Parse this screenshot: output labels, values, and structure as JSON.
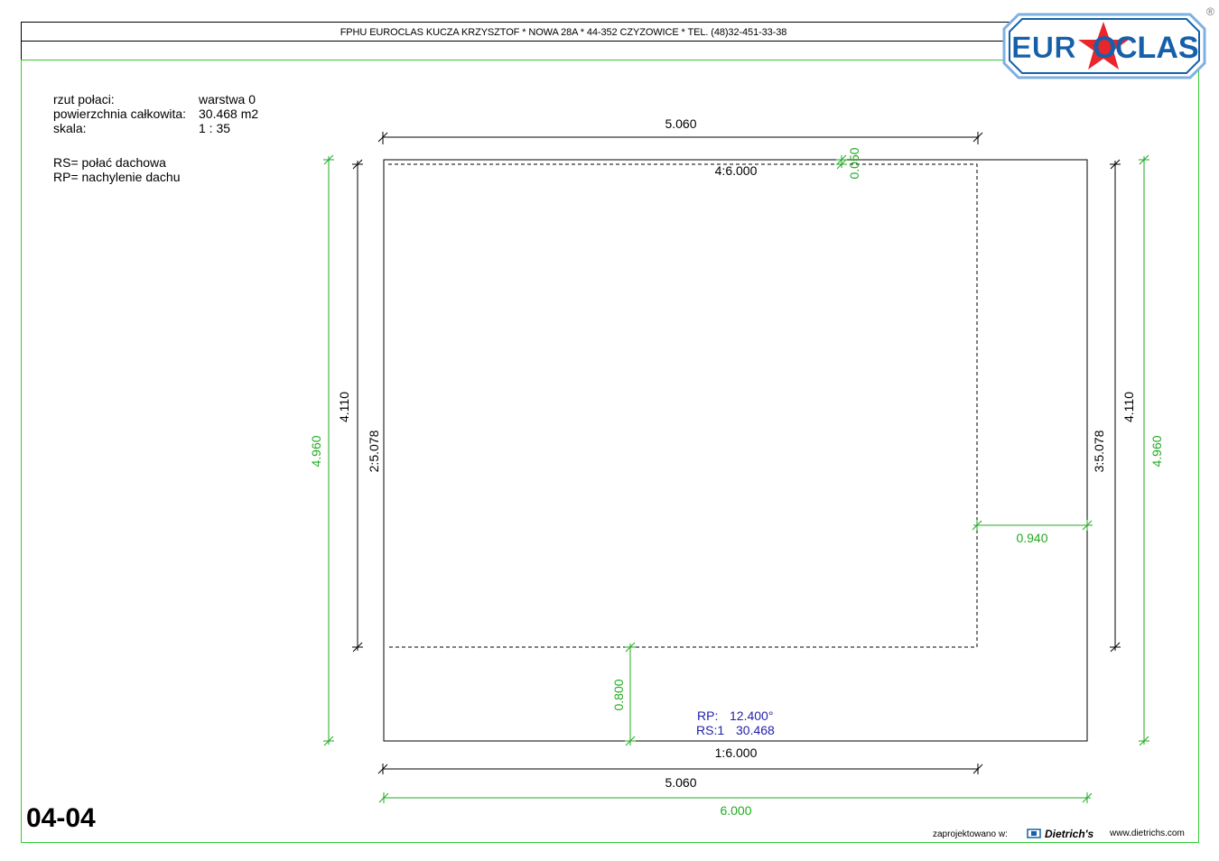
{
  "header": {
    "company": "FPHU EUROCLAS KUCZA KRZYSZTOF * NOWA 28A * 44-352 CZYZOWICE * TEL. (48)32-451-33-38",
    "logo_text_left": "EUR",
    "logo_text_right": "CLAS",
    "registered_mark": "®"
  },
  "info": {
    "rzut_label": "rzut połaci:",
    "rzut_value": "warstwa 0",
    "area_label": "powierzchnia całkowita:",
    "area_value": "30.468 m2",
    "scale_label": "skala:",
    "scale_value": "1 : 35"
  },
  "legend": {
    "rs": "RS= połać dachowa",
    "rp": "RP= nachylenie dachu"
  },
  "drawing": {
    "top_dim": "5.060",
    "top_edge": "4:6.000",
    "top_offset": "0.050",
    "left_outer": "4.960",
    "left_inner": "4.110",
    "left_edge": "2:5.078",
    "right_edge": "3:5.078",
    "right_inner": "4.110",
    "right_outer": "4.960",
    "right_offset": "0.940",
    "bottom_offset": "0.800",
    "rp_label": "RP:",
    "rp_value": "12.400°",
    "rs_label": "RS:1",
    "rs_value": "30.468",
    "bottom_edge": "1:6.000",
    "bottom_dim": "5.060",
    "bottom_total": "6.000"
  },
  "colors": {
    "green": "#33cc33",
    "dim_green": "#22aa22",
    "blue": "#2222aa",
    "logo_blue": "#1560a8",
    "logo_red": "#e8262b"
  },
  "sheet_number": "04-04",
  "footer": {
    "designed_in": "zaprojektowano w:",
    "brand": "Dietrich's",
    "url": "www.dietrichs.com"
  }
}
